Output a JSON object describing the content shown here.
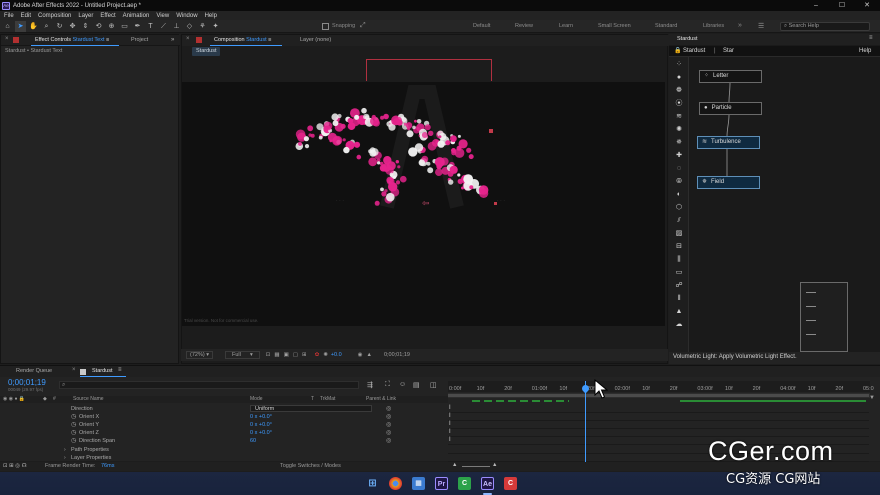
{
  "titlebar": {
    "title": "Adobe After Effects 2022 - Untitled Project.aep *",
    "logo": "Ae"
  },
  "menu": [
    "File",
    "Edit",
    "Composition",
    "Layer",
    "Effect",
    "Animation",
    "View",
    "Window",
    "Help"
  ],
  "toolbar": {
    "snapping_label": "Snapping",
    "workspaces": [
      "Default",
      "Review",
      "Learn",
      "Small Screen",
      "Standard",
      "Libraries"
    ],
    "search_placeholder": "Search Help"
  },
  "left_panel": {
    "tab_effect_controls_prefix": "Effect Controls",
    "tab_effect_controls_layer": "Stardust Text",
    "tab_project": "Project",
    "subtitle": "Stardust • Stardust Text"
  },
  "comp_panel": {
    "tab_composition_prefix": "Composition",
    "tab_composition_name": "Stardust",
    "tab_layer": "Layer (none)",
    "subtab": "Stardust",
    "viewer_footnote": "Trial version. Not for commercial use.",
    "zoom": "(72%)",
    "resolution": "Full",
    "exposure": "+0.0",
    "timecode": "0;00;01;19"
  },
  "right_panel": {
    "tab": "Stardust",
    "breadcrumb_1": "Stardust",
    "breadcrumb_sep": "|",
    "breadcrumb_2": "Star",
    "help": "Help",
    "nodes": [
      {
        "label": "Letter",
        "icon": "dots"
      },
      {
        "label": "Particle",
        "icon": "circle"
      },
      {
        "label": "Turbulence",
        "icon": "waves"
      },
      {
        "label": "Field",
        "icon": "field"
      }
    ],
    "status": "Volumetric Light: Apply Volumetric Light Effect."
  },
  "timeline": {
    "tab_render_queue": "Render Queue",
    "tab_comp": "Stardust",
    "timecode": "0;00;01;19",
    "timecode_sub": "00049 (29.97 fps)",
    "columns": {
      "source_name": "Source Name",
      "mode": "Mode",
      "t": "T",
      "trkmat": "TrkMat",
      "parent": "Parent & Link"
    },
    "rows": [
      {
        "name": "Direction",
        "value": "Uniform",
        "indent": 1
      },
      {
        "name": "Orient X",
        "value": "0 x +0.0°",
        "indent": 2
      },
      {
        "name": "Orient Y",
        "value": "0 x +0.0°",
        "indent": 2
      },
      {
        "name": "Orient Z",
        "value": "0 x +0.0°",
        "indent": 2
      },
      {
        "name": "Direction Span",
        "value": "60",
        "indent": 2
      },
      {
        "name": "Path Properties",
        "value": "",
        "indent": 1
      },
      {
        "name": "Layer Properties",
        "value": "",
        "indent": 1
      }
    ],
    "ruler": [
      "0:00f",
      "10f",
      "20f",
      "01:00f",
      "10f",
      "20f",
      "02:00f",
      "10f",
      "20f",
      "03:00f",
      "10f",
      "20f",
      "04:00f",
      "10f",
      "20f",
      "05:0"
    ],
    "frame_render_label": "Frame Render Time:",
    "frame_render_value": "76ms",
    "toggle_label": "Toggle Switches / Modes"
  },
  "taskbar": {
    "apps": [
      "windows-start",
      "chrome",
      "photos",
      "premiere-pro",
      "camtasia",
      "after-effects",
      "cger"
    ],
    "premiere": "Pr",
    "after_effects": "Ae"
  },
  "watermark": {
    "main": "CGer.com",
    "sub": "CG资源 CG网站"
  },
  "colors": {
    "accent": "#3f9bff",
    "particle_pink": "#e6238c",
    "particle_white": "#f2f2f2",
    "keyframe_green": "#2ecc40"
  }
}
